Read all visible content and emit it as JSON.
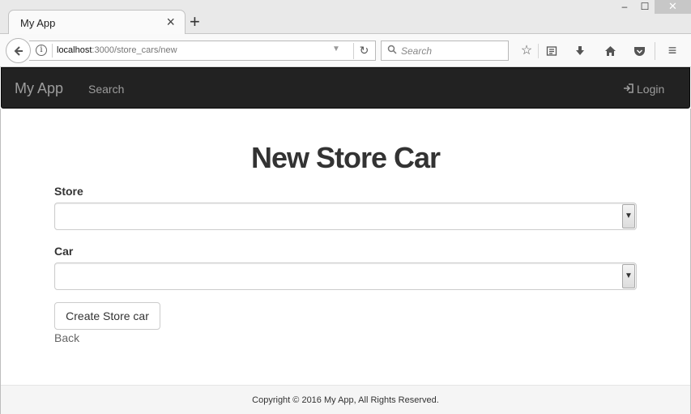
{
  "browser": {
    "tab_title": "My App",
    "tab_close": "×",
    "new_tab": "+",
    "window_controls": {
      "minimize": "–",
      "maximize": "☐",
      "close": "✕"
    },
    "url": {
      "host": "localhost",
      "path": ":3000/store_cars/new"
    },
    "search_placeholder": "Search",
    "icons": {
      "back": "back-arrow-icon",
      "info": "info-icon",
      "reload": "reload-icon",
      "search": "search-icon",
      "bookmark": "star-icon",
      "reader": "reading-list-icon",
      "downloads": "download-icon",
      "home": "home-icon",
      "pocket": "pocket-icon",
      "menu": "hamburger-menu-icon"
    }
  },
  "app_navbar": {
    "brand": "My App",
    "links": [
      "Search"
    ],
    "login_label": "Login",
    "login_icon": "login-icon"
  },
  "form": {
    "title": "New Store Car",
    "store_label": "Store",
    "store_value": "",
    "car_label": "Car",
    "car_value": "",
    "submit_label": "Create Store car",
    "back_label": "Back"
  },
  "footer": {
    "text": "Copyright © 2016 My App, All Rights Reserved."
  },
  "colors": {
    "navbar_bg": "#222222",
    "navbar_text": "#9d9d9d",
    "footer_bg": "#f5f5f5",
    "heading": "#333333"
  }
}
